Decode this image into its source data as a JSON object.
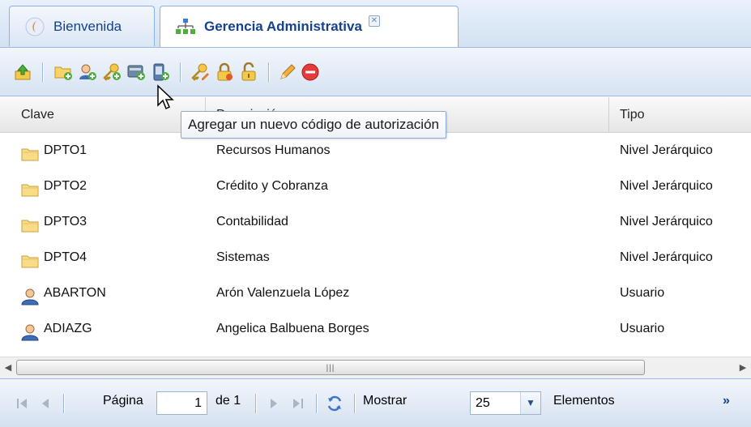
{
  "tabs": [
    {
      "label": "Bienvenida",
      "icon": "welcome-icon",
      "active": false
    },
    {
      "label": "Gerencia Administrativa",
      "icon": "org-chart-icon",
      "active": true,
      "closable": true
    }
  ],
  "toolbar": {
    "items": [
      "upload-icon",
      "add-folder-icon",
      "add-user-icon",
      "add-key-icon",
      "card-icon",
      "device-icon",
      "key-edit-icon",
      "lock-icon",
      "unlock-icon",
      "pencil-icon",
      "delete-icon"
    ]
  },
  "tooltip": "Agregar un nuevo código de autorización",
  "grid": {
    "columns": [
      "Clave",
      "Descripción",
      "Tipo"
    ],
    "rows": [
      {
        "key": "DPTO1",
        "desc": "Recursos Humanos",
        "type": "Nivel Jerárquico",
        "icon": "folder-icon"
      },
      {
        "key": "DPTO2",
        "desc": "Crédito y Cobranza",
        "type": "Nivel Jerárquico",
        "icon": "folder-icon"
      },
      {
        "key": "DPTO3",
        "desc": "Contabilidad",
        "type": "Nivel Jerárquico",
        "icon": "folder-icon"
      },
      {
        "key": "DPTO4",
        "desc": "Sistemas",
        "type": "Nivel Jerárquico",
        "icon": "folder-icon"
      },
      {
        "key": "ABARTON",
        "desc": "Arón Valenzuela López",
        "type": "Usuario",
        "icon": "user-icon"
      },
      {
        "key": "ADIAZG",
        "desc": "Angelica Balbuena Borges",
        "type": "Usuario",
        "icon": "user-icon"
      }
    ]
  },
  "pager": {
    "page_label": "Página",
    "page_value": "1",
    "of_label": "de 1",
    "show_label": "Mostrar",
    "page_size": "25",
    "items_label": "Elementos",
    "more": "»"
  }
}
